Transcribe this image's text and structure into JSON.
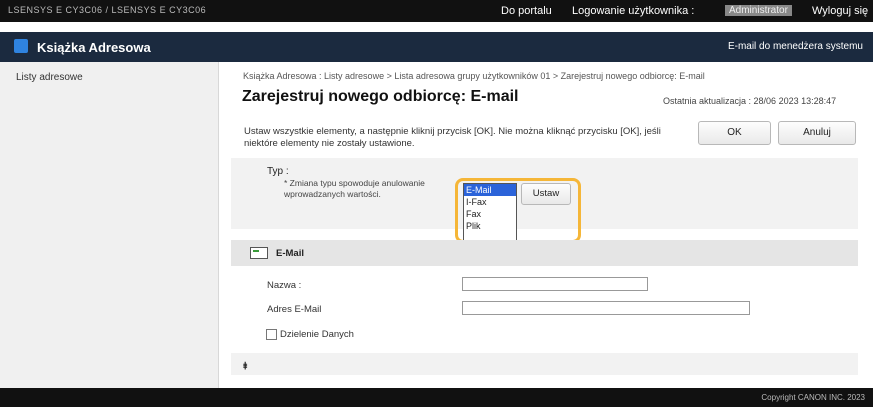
{
  "topbar": {
    "device": "LSENSYS E CY3C06 / LSENSYS E CY3C06",
    "portal_link": "Do portalu",
    "login_label": "Logowanie użytkownika :",
    "user_name": "Administrator",
    "logout_link": "Wyloguj się"
  },
  "appbar": {
    "title": "Książka Adresowa",
    "email_admin": "E-mail do menedżera systemu"
  },
  "sidebar": {
    "items": [
      {
        "label": "Listy adresowe"
      }
    ]
  },
  "breadcrumb": "Książka Adresowa : Listy adresowe > Lista adresowa grupy użytkowników 01 > Zarejestruj nowego odbiorcę: E-mail",
  "page_title": "Zarejestruj nowego odbiorcę: E-mail",
  "last_update": "Ostatnia aktualizacja : 28/06 2023 13:28:47",
  "instructions": "Ustaw wszystkie elementy, a następnie kliknij przycisk [OK]. Nie można kliknąć przycisku [OK], jeśli niektóre elementy nie zostały ustawione.",
  "buttons": {
    "ok": "OK",
    "cancel": "Anuluj",
    "set": "Ustaw"
  },
  "type_section": {
    "label": "Typ :",
    "note": "* Zmiana typu spowoduje anulowanie wprowadzanych wartości.",
    "options": [
      "E-Mail",
      "I-Fax",
      "Fax",
      "Plik"
    ],
    "selected": "E-Mail"
  },
  "email_section": {
    "title": "E-Mail",
    "name_label": "Nazwa :",
    "name_value": "",
    "address_label": "Adres E-Mail",
    "address_value": "",
    "split_data_label": "Dzielenie Danych",
    "split_data_checked": false
  },
  "to_top": "⯒",
  "footer": {
    "copyright": "Copyright CANON INC. 2023"
  },
  "colors": {
    "topbar": "#111111",
    "appbar": "#1b2a3f",
    "accent_icon": "#2f83e0",
    "highlight": "#f5b638",
    "selected_option": "#2b63d9"
  }
}
